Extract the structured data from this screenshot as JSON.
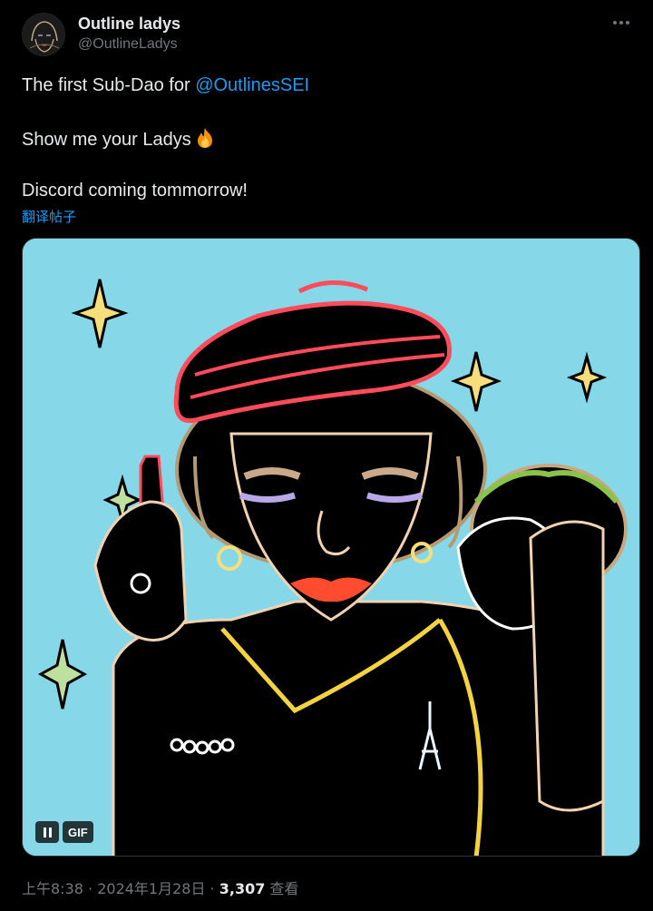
{
  "author": {
    "display_name": "Outline ladys",
    "handle": "@OutlineLadys"
  },
  "tweet": {
    "line1_text": "The first Sub-Dao for ",
    "line1_mention": "@OutlinesSEI",
    "line2_text": "Show me your Ladys",
    "line2_emoji": "fire-emoji",
    "line3_text": "Discord coming tommorrow!",
    "translate_label": "翻译帖子"
  },
  "media": {
    "type": "gif",
    "badge_label": "GIF",
    "pause_icon": "pause-icon",
    "background_color": "#86d8e8"
  },
  "meta": {
    "time": "上午8:38",
    "separator1": " · ",
    "date": "2024年1月28日",
    "separator2": " · ",
    "views_count": "3,307",
    "views_label": " 查看"
  },
  "icons": {
    "more": "more-horizontal-icon"
  }
}
